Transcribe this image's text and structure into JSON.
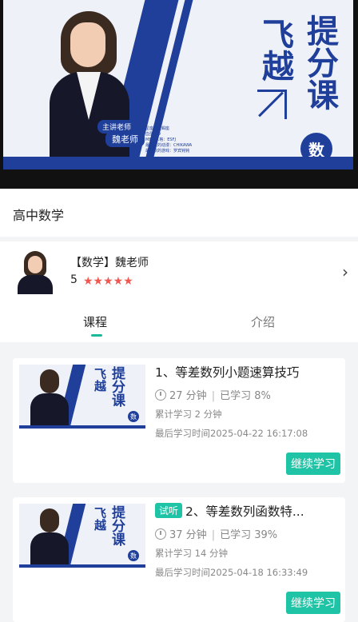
{
  "banner": {
    "title_line1": "飞越",
    "title_line2": "提分课",
    "subject_badge": "数",
    "teacher_role": "主讲老师",
    "teacher_name": "魏老师",
    "small_info": [
      "星座：天蝎座",
      "血型：O",
      "MBTI人格：ESFJ",
      "最喜欢的动漫：CHIKAWA",
      "最喜欢的游戏：罗宾钝钝"
    ]
  },
  "course_category": "高中数学",
  "teacher": {
    "name": "【数学】魏老师",
    "rating": "5",
    "stars": "★★★★★"
  },
  "tabs": [
    {
      "label": "课程",
      "active": true
    },
    {
      "label": "介绍",
      "active": false
    }
  ],
  "lessons": [
    {
      "title": "1、等差数列小题速算技巧",
      "trial": "",
      "duration": "27 分钟",
      "learned": "已学习 8%",
      "total": "累计学习 2 分钟",
      "last": "最后学习时间2025-04-22 16:17:08",
      "button": "继续学习",
      "thumb_title_a": "飞越",
      "thumb_title_b": "提分课",
      "thumb_badge": "数"
    },
    {
      "title": "2、等差数列函数特...",
      "trial": "试听",
      "duration": "37 分钟",
      "learned": "已学习 39%",
      "total": "累计学习 14 分钟",
      "last": "最后学习时间2025-04-18 16:33:49",
      "button": "继续学习",
      "thumb_title_a": "飞越",
      "thumb_title_b": "提分课",
      "thumb_badge": "数"
    }
  ],
  "colors": {
    "brand_blue": "#1f3f9b",
    "accent_green": "#1fc4a6",
    "star_red": "#f0574f"
  }
}
